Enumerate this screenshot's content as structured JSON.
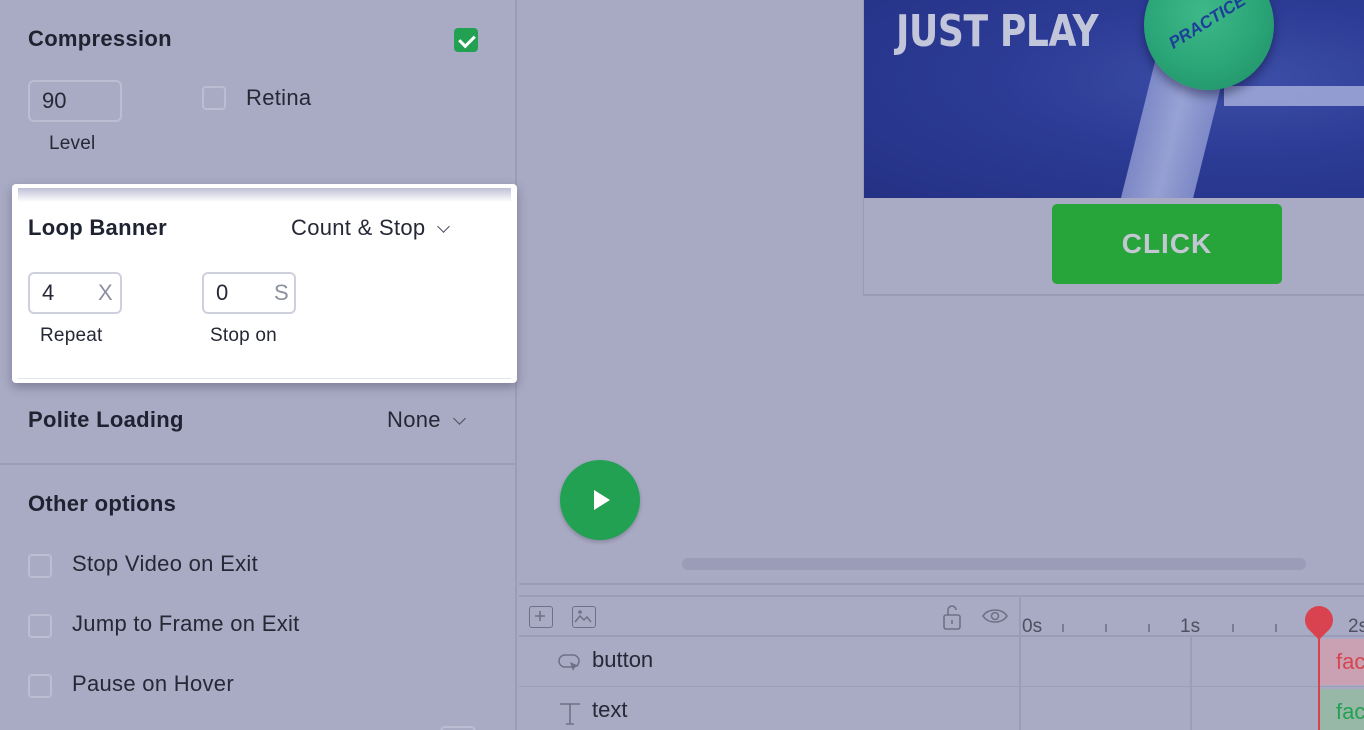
{
  "compression": {
    "title": "Compression",
    "enabled": true,
    "level_value": "90",
    "level_label": "Level",
    "retina_label": "Retina",
    "retina_checked": false
  },
  "loop_banner": {
    "title": "Loop Banner",
    "mode": "Count & Stop",
    "repeat_value": "4",
    "repeat_unit": "X",
    "repeat_label": "Repeat",
    "stop_value": "0",
    "stop_unit": "S",
    "stop_label": "Stop on"
  },
  "polite_loading": {
    "title": "Polite Loading",
    "mode": "None"
  },
  "other_options": {
    "title": "Other options",
    "items": [
      {
        "label": "Stop Video on Exit",
        "checked": false
      },
      {
        "label": "Jump to Frame on Exit",
        "checked": false
      },
      {
        "label": "Pause on Hover",
        "checked": false
      }
    ]
  },
  "banner": {
    "headline": "JUST PLAY",
    "ball_text": "PRACTICE",
    "cta_label": "CLICK"
  },
  "timeline": {
    "ticks": [
      "0s",
      "1s",
      "2s"
    ],
    "layers": [
      {
        "name": "button",
        "clip": "fac"
      },
      {
        "name": "text",
        "clip": "fac"
      }
    ]
  },
  "colors": {
    "accent_green": "#23a153",
    "playhead_red": "#d9434f",
    "panel_bg": "#a9aac4"
  }
}
